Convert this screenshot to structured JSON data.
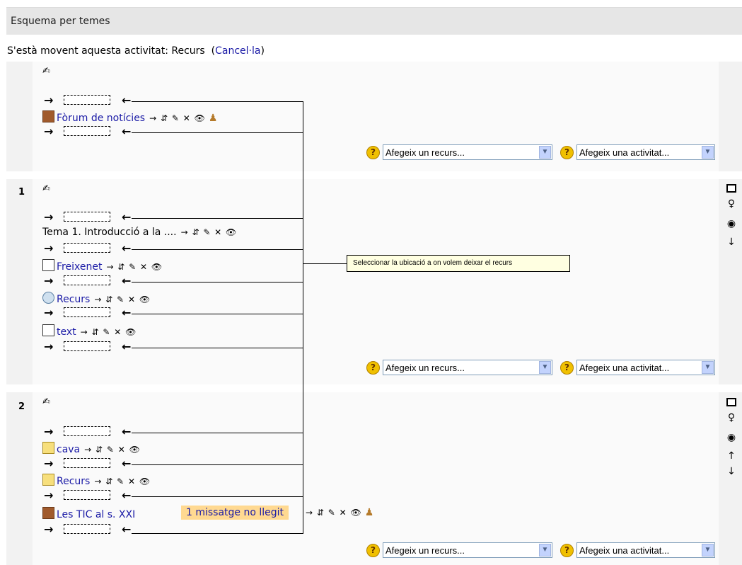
{
  "header": {
    "title": "Esquema per temes"
  },
  "moving": {
    "text": "S'està movent aquesta activitat: Recurs",
    "cancel_open": "(",
    "cancel_label": "Cancel·la",
    "cancel_close": ")"
  },
  "section0": {
    "activities": [
      {
        "label": "Fòrum de notícies",
        "icon": "forum-icon"
      }
    ]
  },
  "section1": {
    "number": "1",
    "activities": [
      {
        "label": "Tema 1. Introducció a la ....",
        "icon": "none",
        "link": false
      },
      {
        "label": "Freixenet",
        "icon": "document-icon",
        "link": true
      },
      {
        "label": "Recurs",
        "icon": "resource-icon",
        "link": true
      },
      {
        "label": "text",
        "icon": "document-icon",
        "link": true
      }
    ]
  },
  "section2": {
    "number": "2",
    "activities": [
      {
        "label": "cava",
        "icon": "folder-icon"
      },
      {
        "label": "Recurs",
        "icon": "folder-icon"
      },
      {
        "label": "Les TIC al s. XXI",
        "icon": "forum-icon"
      }
    ],
    "unread_badge": "1 missatge no llegit"
  },
  "selects": {
    "add_resource": "Afegeix un recurs...",
    "add_activity": "Afegeix una activitat..."
  },
  "callout": {
    "text": "Seleccionar la ubicació a on volem deixar el recurs"
  },
  "glyphs": {
    "move_here_arrow": "→",
    "target_arrow": "←",
    "tools": "→ ⇵ ✎ ✕ 👁",
    "help": "?",
    "dropdown": "▼"
  }
}
